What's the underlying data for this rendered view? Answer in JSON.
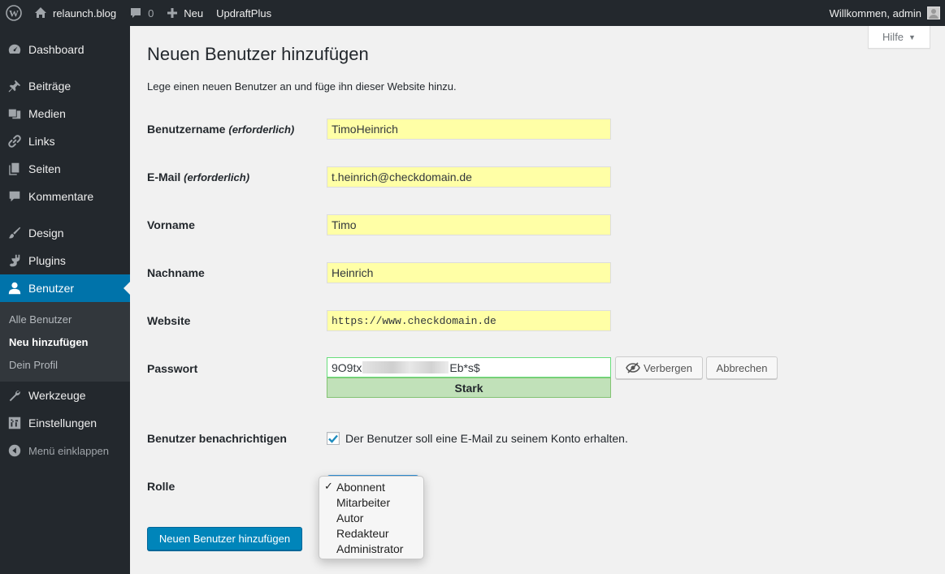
{
  "adminbar": {
    "site_name": "relaunch.blog",
    "comments_count": "0",
    "new_label": "Neu",
    "plugin_label": "UpdraftPlus",
    "welcome": "Willkommen, admin"
  },
  "sidebar": {
    "items": [
      {
        "label": "Dashboard",
        "icon": "dashboard-icon"
      },
      {
        "label": "Beiträge",
        "icon": "pin-icon"
      },
      {
        "label": "Medien",
        "icon": "media-icon"
      },
      {
        "label": "Links",
        "icon": "link-icon"
      },
      {
        "label": "Seiten",
        "icon": "pages-icon"
      },
      {
        "label": "Kommentare",
        "icon": "comment-icon"
      },
      {
        "label": "Design",
        "icon": "brush-icon"
      },
      {
        "label": "Plugins",
        "icon": "plugin-icon"
      },
      {
        "label": "Benutzer",
        "icon": "user-icon"
      },
      {
        "label": "Werkzeuge",
        "icon": "wrench-icon"
      },
      {
        "label": "Einstellungen",
        "icon": "settings-icon"
      },
      {
        "label": "Menü einklappen",
        "icon": "collapse-icon"
      }
    ],
    "submenu": [
      "Alle Benutzer",
      "Neu hinzufügen",
      "Dein Profil"
    ]
  },
  "help": {
    "label": "Hilfe"
  },
  "page": {
    "title": "Neuen Benutzer hinzufügen",
    "description": "Lege einen neuen Benutzer an und füge ihn dieser Website hinzu."
  },
  "form": {
    "username_label": "Benutzername",
    "required": "(erforderlich)",
    "username_value": "TimoHeinrich",
    "email_label": "E-Mail",
    "email_value": "t.heinrich@checkdomain.de",
    "firstname_label": "Vorname",
    "firstname_value": "Timo",
    "lastname_label": "Nachname",
    "lastname_value": "Heinrich",
    "website_label": "Website",
    "website_value": "https://www.checkdomain.de",
    "password_label": "Passwort",
    "password_start": "9O9tx",
    "password_end": "Eb*s$",
    "password_strength": "Stark",
    "hide_label": "Verbergen",
    "cancel_label": "Abbrechen",
    "notify_label": "Benutzer benachrichtigen",
    "notify_text": "Der Benutzer soll eine E-Mail zu seinem Konto erhalten.",
    "role_label": "Rolle",
    "role_options": [
      "Abonnent",
      "Mitarbeiter",
      "Autor",
      "Redakteur",
      "Administrator"
    ],
    "role_selected_mark": "✓",
    "submit_label": "Neuen Benutzer hinzufügen"
  },
  "colors": {
    "adminbar": "#23282d",
    "accent": "#0073aa",
    "primary_button": "#0085ba",
    "autofill": "#ffffa6",
    "strength": "#c1e1b9"
  }
}
